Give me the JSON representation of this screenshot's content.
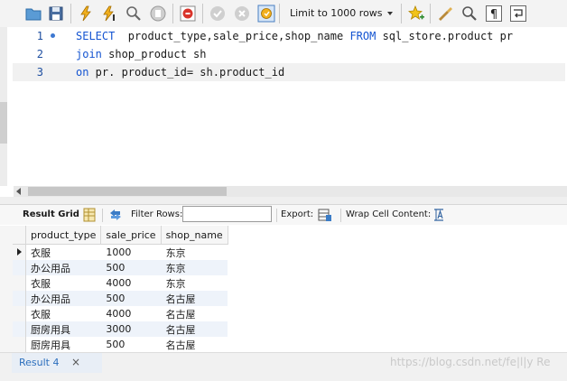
{
  "toolbar": {
    "limit_label": "Limit to 1000 rows",
    "icons": [
      "folder-icon",
      "save-icon",
      "lightning-icon",
      "lightning-cursor-icon",
      "magnifier-icon",
      "stop-icon",
      "stop-on-error-icon",
      "commit-icon",
      "rollback-icon",
      "autocommit-icon",
      "star-add-icon",
      "beautify-icon",
      "find-icon",
      "invisible-chars-icon",
      "wrap-icon"
    ]
  },
  "editor": {
    "lines": [
      {
        "num": "1",
        "kw1": "SELECT",
        "mid": "  product_type,sale_price,shop_name ",
        "kw2": "FROM",
        "rest": " sql_store.product pr"
      },
      {
        "num": "2",
        "kw1": "join",
        "mid": " shop_product sh",
        "kw2": "",
        "rest": ""
      },
      {
        "num": "3",
        "kw1": "on",
        "mid": " pr. product_id= sh.product_id",
        "kw2": "",
        "rest": ""
      }
    ]
  },
  "result_toolbar": {
    "result_grid": "Result Grid",
    "filter_rows": "Filter Rows:",
    "filter_value": "",
    "export": "Export:",
    "wrap": "Wrap Cell Content:"
  },
  "grid": {
    "columns": [
      "product_type",
      "sale_price",
      "shop_name"
    ],
    "rows": [
      [
        "衣服",
        "1000",
        "东京"
      ],
      [
        "办公用品",
        "500",
        "东京"
      ],
      [
        "衣服",
        "4000",
        "东京"
      ],
      [
        "办公用品",
        "500",
        "名古屋"
      ],
      [
        "衣服",
        "4000",
        "名古屋"
      ],
      [
        "厨房用具",
        "3000",
        "名古屋"
      ],
      [
        "厨房用具",
        "500",
        "名古屋"
      ]
    ]
  },
  "tabs": {
    "result_tab": "Result 4",
    "close": "×"
  },
  "watermark": "https://blog.csdn.net/fe|l|y Re"
}
